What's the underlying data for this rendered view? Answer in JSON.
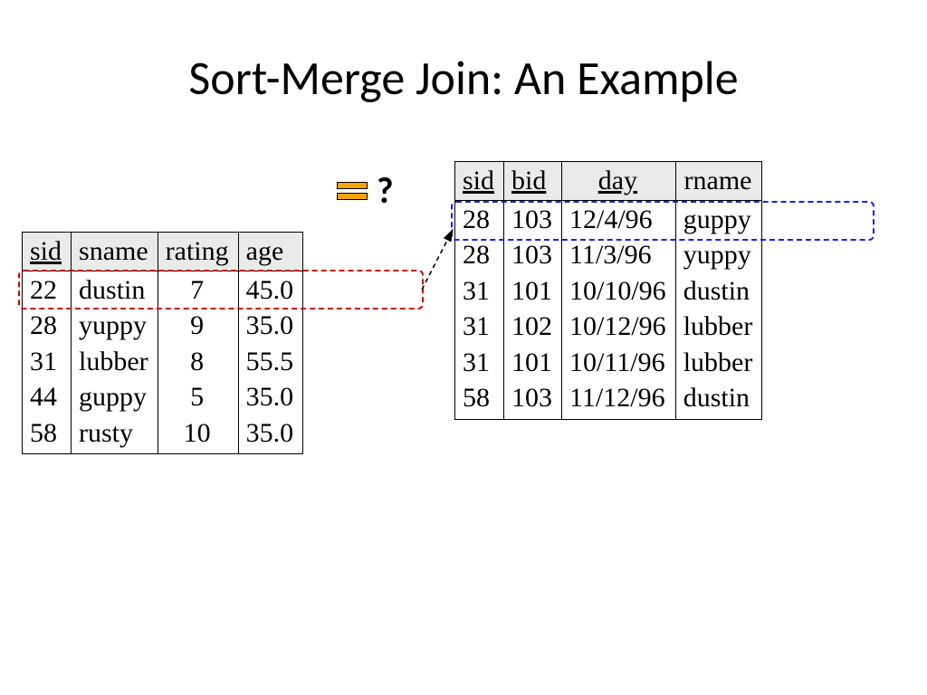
{
  "title": "Sort-Merge Join: An Example",
  "question_mark": "?",
  "left_table": {
    "headers": [
      "sid",
      "sname",
      "rating",
      "age"
    ],
    "underline": [
      true,
      false,
      false,
      false
    ],
    "rows": [
      {
        "sid": "22",
        "sname": "dustin",
        "rating": "7",
        "age": "45.0"
      },
      {
        "sid": "28",
        "sname": "yuppy",
        "rating": "9",
        "age": "35.0"
      },
      {
        "sid": "31",
        "sname": "lubber",
        "rating": "8",
        "age": "55.5"
      },
      {
        "sid": "44",
        "sname": "guppy",
        "rating": "5",
        "age": "35.0"
      },
      {
        "sid": "58",
        "sname": "rusty",
        "rating": "10",
        "age": "35.0"
      }
    ]
  },
  "right_table": {
    "headers": [
      "sid",
      "bid",
      "day",
      "rname"
    ],
    "underline": [
      true,
      true,
      true,
      false
    ],
    "rows": [
      {
        "sid": "28",
        "bid": "103",
        "day": "12/4/96",
        "rname": "guppy"
      },
      {
        "sid": "28",
        "bid": "103",
        "day": "11/3/96",
        "rname": "yuppy"
      },
      {
        "sid": "31",
        "bid": "101",
        "day": "10/10/96",
        "rname": "dustin"
      },
      {
        "sid": "31",
        "bid": "102",
        "day": "10/12/96",
        "rname": "lubber"
      },
      {
        "sid": "31",
        "bid": "101",
        "day": "10/11/96",
        "rname": "lubber"
      },
      {
        "sid": "58",
        "bid": "103",
        "day": "11/12/96",
        "rname": "dustin"
      }
    ]
  },
  "highlights": {
    "left_row_index": 0,
    "right_row_index": 0
  }
}
